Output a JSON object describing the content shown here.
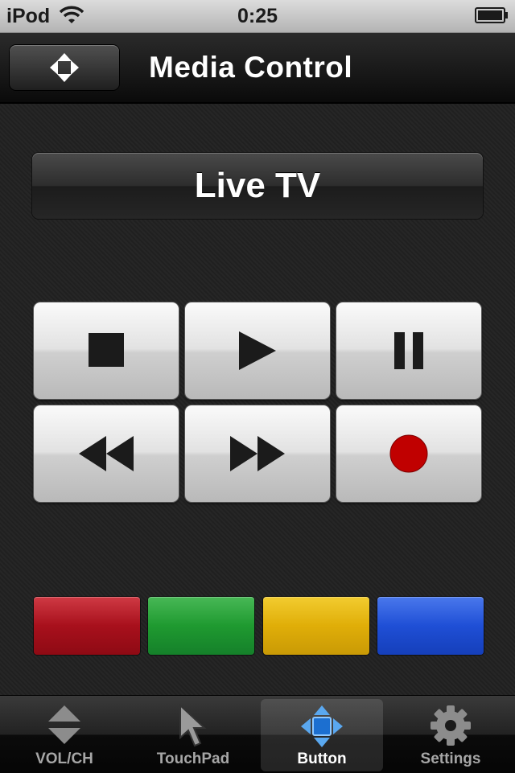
{
  "status": {
    "carrier": "iPod",
    "time": "0:25"
  },
  "nav": {
    "title": "Media Control",
    "left_button_icon": "four-arrows-icon"
  },
  "mode": {
    "label": "Live TV"
  },
  "media_buttons": [
    {
      "name": "stop-button",
      "icon": "stop-icon"
    },
    {
      "name": "play-button",
      "icon": "play-icon"
    },
    {
      "name": "pause-button",
      "icon": "pause-icon"
    },
    {
      "name": "rewind-button",
      "icon": "rewind-icon"
    },
    {
      "name": "fast-forward-button",
      "icon": "fast-forward-icon"
    },
    {
      "name": "record-button",
      "icon": "record-icon",
      "color": "#c00000"
    }
  ],
  "color_buttons": [
    {
      "name": "red-button",
      "color": "#b0131f"
    },
    {
      "name": "green-button",
      "color": "#1e9a2e"
    },
    {
      "name": "yellow-button",
      "color": "#e3b40d"
    },
    {
      "name": "blue-button",
      "color": "#1d4fd4"
    }
  ],
  "tabs": [
    {
      "label": "VOL/CH",
      "icon": "up-down-arrows-icon",
      "selected": false
    },
    {
      "label": "TouchPad",
      "icon": "cursor-arrow-icon",
      "selected": false
    },
    {
      "label": "Button",
      "icon": "direction-pad-icon",
      "selected": true
    },
    {
      "label": "Settings",
      "icon": "gear-icon",
      "selected": false
    }
  ]
}
